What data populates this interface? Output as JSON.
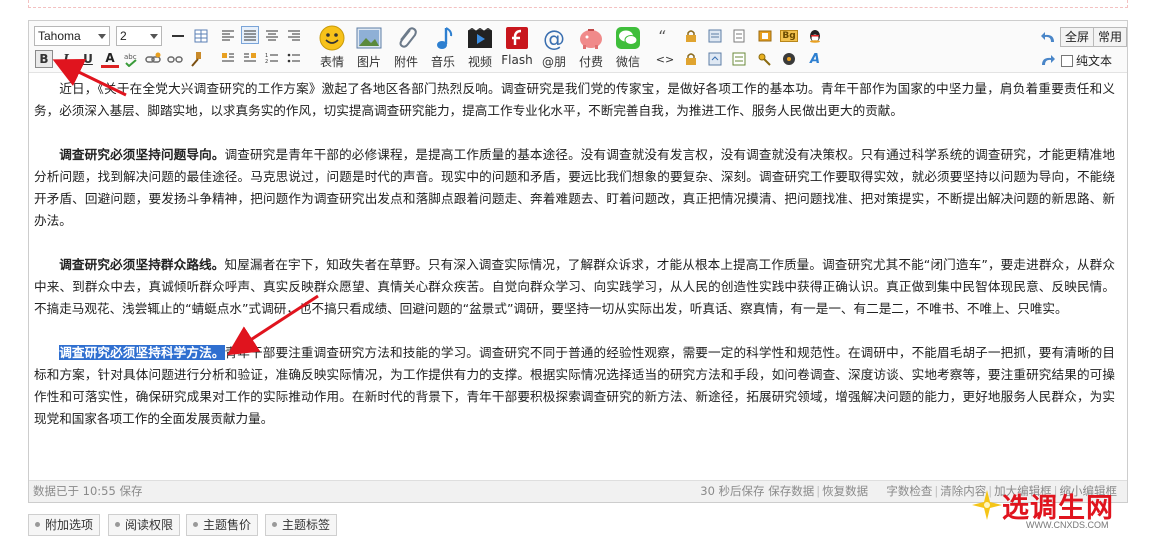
{
  "toolbar": {
    "font_family": "Tahoma",
    "font_size": "2",
    "big_tools": [
      {
        "label": "表情",
        "icon": "smiley-icon"
      },
      {
        "label": "图片",
        "icon": "image-icon"
      },
      {
        "label": "附件",
        "icon": "paperclip-icon"
      },
      {
        "label": "音乐",
        "icon": "music-note-icon"
      },
      {
        "label": "视频",
        "icon": "video-icon"
      },
      {
        "label": "Flash",
        "icon": "flash-icon"
      },
      {
        "label": "@朋",
        "icon": "at-icon"
      },
      {
        "label": "付费",
        "icon": "piggy-bank-icon"
      },
      {
        "label": "微信",
        "icon": "wechat-icon"
      }
    ],
    "fullscreen": "全屏",
    "common": "常用",
    "plain_text": "纯文本",
    "bold": "B",
    "italic": "I",
    "underline": "U",
    "fontcolor": "A",
    "bg_label": "Bg",
    "code_label": "<>",
    "ai_label": "A"
  },
  "content": {
    "p1": "近日，《关于在全党大兴调查研究的工作方案》激起了各地区各部门热烈反响。调查研究是我们党的传家宝，是做好各项工作的基本功。青年干部作为国家的中坚力量，肩负着重要责任和义务，必须深入基层、脚踏实地，以求真务实的作风，切实提高调查研究能力，提高工作专业化水平，不断完善自我，为推进工作、服务人民做出更大的贡献。",
    "p2_bold": "调查研究必须坚持问题导向。",
    "p2": "调查研究是青年干部的必修课程，是提高工作质量的基本途径。没有调查就没有发言权，没有调查就没有决策权。只有通过科学系统的调查研究，才能更精准地分析问题，找到解决问题的最佳途径。马克思说过，问题是时代的声音。现实中的问题和矛盾，要远比我们想象的要复杂、深刻。调查研究工作要取得实效，就必须要坚持以问题为导向，不能绕开矛盾、回避问题，要发扬斗争精神，把问题作为调查研究出发点和落脚点跟着问题走、奔着难题去、盯着问题改，真正把情况摸清、把问题找准、把对策提实，不断提出解决问题的新思路、新办法。",
    "p3_bold": "调查研究必须坚持群众路线。",
    "p3": "知屋漏者在宇下，知政失者在草野。只有深入调查实际情况，了解群众诉求，才能从根本上提高工作质量。调查研究尤其不能“闭门造车”，要走进群众，从群众中来、到群众中去，真诚倾听群众呼声、真实反映群众愿望、真情关心群众疾苦。自觉向群众学习、向实践学习，从人民的创造性实践中获得正确认识。真正做到集中民智体现民意、反映民情。不搞走马观花、浅尝辄止的“蜻蜓点水”式调研，也不搞只看成绩、回避问题的“盆景式”调研，要坚持一切从实际出发，听真话、察真情，有一是一、有二是二，不唯书、不唯上、只唯实。",
    "p4_bold": "调查研究必须坚持科学方法。",
    "p4": "青年干部要注重调查研究方法和技能的学习。调查研究不同于普通的经验性观察，需要一定的科学性和规范性。在调研中，不能眉毛胡子一把抓，要有清晰的目标和方案，针对具体问题进行分析和验证，准确反映实际情况，为工作提供有力的支撑。根据实际情况选择适当的研究方法和手段，如问卷调查、深度访谈、实地考察等，要注重研究结果的可操作性和可落实性，确保研究成果对工作的实际推动作用。在新时代的背景下，青年干部要积极探索调查研究的新方法、新途径，拓展研究领域，增强解决问题的能力，更好地服务人民群众，为实现党和国家各项工作的全面发展贡献力量。"
  },
  "status": {
    "saved": "数据已于 10:55 保存",
    "autosave": "30 秒后保存 保存数据",
    "restore": "恢复数据",
    "wordcount": "字数检查",
    "clear": "清除内容",
    "expand": "加大编辑框",
    "shrink": "缩小编辑框"
  },
  "tabs": [
    "附加选项",
    "阅读权限",
    "主题售价",
    "主题标签"
  ],
  "watermark": {
    "title": "选调生网",
    "url": "WWW.CNXDS.COM"
  },
  "colors": {
    "selection": "#2f6fd0",
    "arrow": "#e0141e",
    "brand_red": "#e0141e"
  }
}
